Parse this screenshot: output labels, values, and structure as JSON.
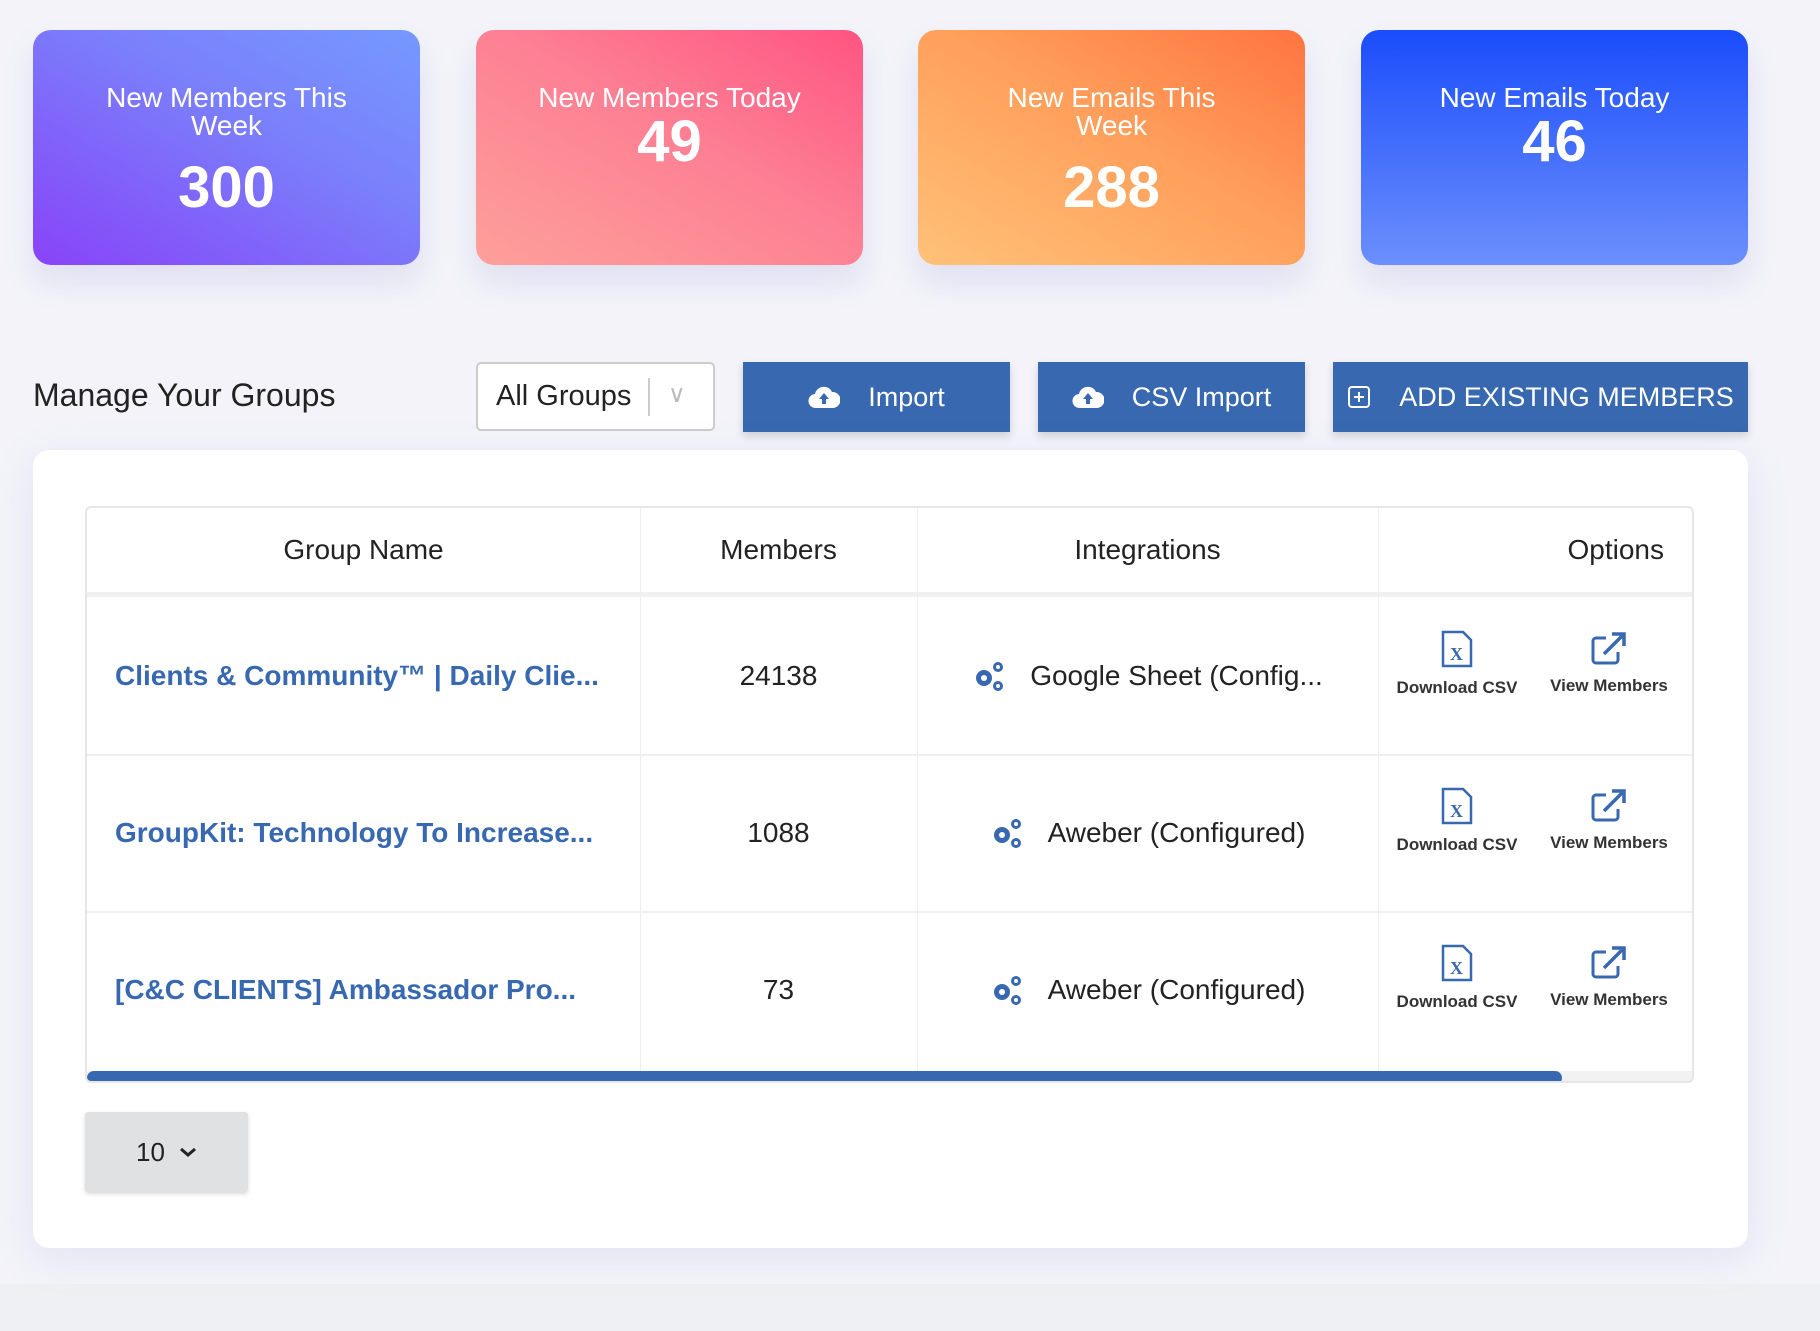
{
  "stats": [
    {
      "label": "New Members This Week",
      "value": "300"
    },
    {
      "label": "New Members Today",
      "value": "49"
    },
    {
      "label": "New Emails This Week",
      "value": "288"
    },
    {
      "label": "New Emails Today",
      "value": "46"
    }
  ],
  "toolbar": {
    "title": "Manage Your Groups",
    "group_filter": "All Groups",
    "import_label": "Import",
    "csv_import_label": "CSV Import",
    "add_existing_label": "ADD EXISTING MEMBERS"
  },
  "table": {
    "headers": [
      "Group Name",
      "Members",
      "Integrations",
      "Options"
    ],
    "rows": [
      {
        "name": "Clients & Community™ | Daily Clie...",
        "members": "24138",
        "integration": "Google Sheet (Config..."
      },
      {
        "name": "GroupKit: Technology To Increase...",
        "members": "1088",
        "integration": "Aweber (Configured)"
      },
      {
        "name": "[C&C CLIENTS] Ambassador Pro...",
        "members": "73",
        "integration": "Aweber (Configured)"
      }
    ],
    "download_label": "Download CSV",
    "view_label": "View Members"
  },
  "pagination": {
    "page_size": "10"
  },
  "colors": {
    "accent": "#3768b0"
  }
}
